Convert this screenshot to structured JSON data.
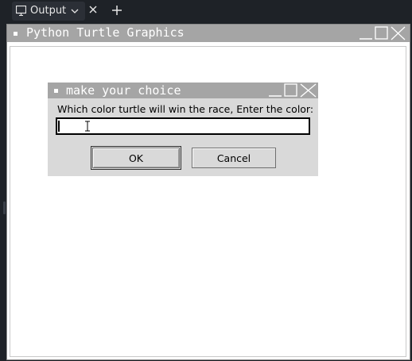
{
  "tab": {
    "label": "Output"
  },
  "window": {
    "title": "Python Turtle Graphics"
  },
  "dialog": {
    "title": "make your choice",
    "prompt": "Which color turtle will win the race, Enter the color:",
    "input_value": "",
    "ok_label": "OK",
    "cancel_label": "Cancel"
  },
  "colors": {
    "tabbar_bg": "#1e2227",
    "titlebar_bg": "#a5a5a5",
    "dialog_bg": "#d9d9d9"
  }
}
